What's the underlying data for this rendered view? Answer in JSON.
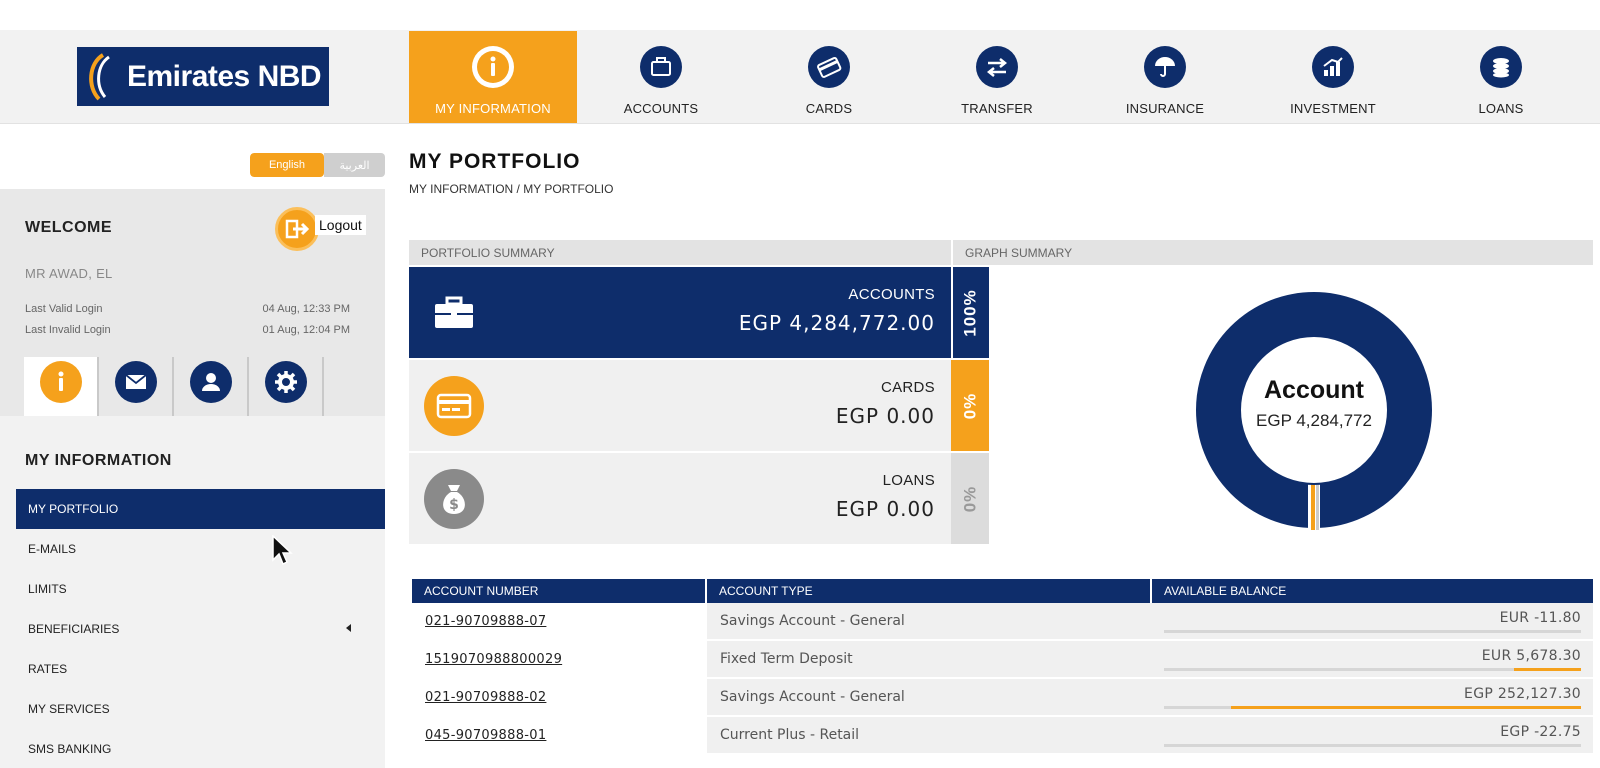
{
  "brand": {
    "name": "Emirates NBD",
    "color": "#0e2d6b",
    "accent": "#f5a11c"
  },
  "nav": [
    {
      "label": "MY INFORMATION",
      "icon": "info-icon",
      "active": true
    },
    {
      "label": "ACCOUNTS",
      "icon": "briefcase-icon"
    },
    {
      "label": "CARDS",
      "icon": "card-icon"
    },
    {
      "label": "TRANSFER",
      "icon": "transfer-arrows-icon"
    },
    {
      "label": "INSURANCE",
      "icon": "umbrella-icon"
    },
    {
      "label": "INVESTMENT",
      "icon": "growth-chart-icon"
    },
    {
      "label": "LOANS",
      "icon": "coins-icon"
    }
  ],
  "language": {
    "english": "English",
    "arabic": "العربية",
    "selected": "English"
  },
  "welcome": {
    "title": "WELCOME",
    "logout": "Logout",
    "user": "MR AWAD, EL",
    "last_valid_label": "Last Valid Login",
    "last_valid_value": "04 Aug, 12:33 PM",
    "last_invalid_label": "Last Invalid Login",
    "last_invalid_value": "01 Aug, 12:04 PM",
    "tabs": [
      "info-icon",
      "mail-icon",
      "user-icon",
      "gear-icon"
    ]
  },
  "sidebar": {
    "title": "MY INFORMATION",
    "items": [
      {
        "label": "MY PORTFOLIO",
        "active": true
      },
      {
        "label": "E-MAILS"
      },
      {
        "label": "LIMITS"
      },
      {
        "label": "BENEFICIARIES",
        "has_submenu": true
      },
      {
        "label": "RATES"
      },
      {
        "label": "MY SERVICES"
      },
      {
        "label": "SMS BANKING"
      }
    ]
  },
  "main": {
    "title": "MY PORTFOLIO",
    "breadcrumb": "MY INFORMATION / MY PORTFOLIO",
    "portfolio_header": "PORTFOLIO SUMMARY",
    "graph_header": "GRAPH SUMMARY",
    "summary": [
      {
        "label": "ACCOUNTS",
        "amount": "EGP 4,284,772.00",
        "percent": "100%",
        "icon": "briefcase-icon"
      },
      {
        "label": "CARDS",
        "amount": "EGP 0.00",
        "percent": "0%",
        "icon": "card-icon"
      },
      {
        "label": "LOANS",
        "amount": "EGP 0.00",
        "percent": "0%",
        "icon": "money-bag-icon"
      }
    ],
    "donut": {
      "title": "Account",
      "subtitle": "EGP 4,284,772",
      "share": 1.0
    }
  },
  "table": {
    "headers": [
      "ACCOUNT NUMBER",
      "ACCOUNT TYPE",
      "AVAILABLE BALANCE"
    ],
    "rows": [
      {
        "number": "021-90709888-07",
        "type": "Savings Account - General",
        "balance": "EUR -11.80",
        "bar": 0.0
      },
      {
        "number": "1519070988800029",
        "type": "Fixed Term Deposit",
        "balance": "EUR 5,678.30",
        "bar": 0.16
      },
      {
        "number": "021-90709888-02",
        "type": "Savings Account - General",
        "balance": "EGP 252,127.30",
        "bar": 0.84
      },
      {
        "number": "045-90709888-01",
        "type": "Current Plus - Retail",
        "balance": "EGP -22.75",
        "bar": 0.0
      }
    ]
  }
}
